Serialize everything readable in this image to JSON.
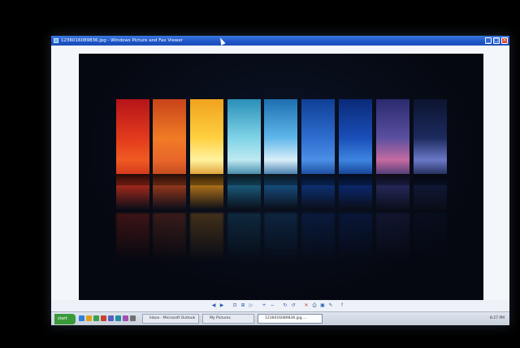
{
  "window": {
    "title": "1236016089836.jpg - Windows Picture and Fax Viewer",
    "minimize_icon": "minimize-icon",
    "maximize_icon": "maximize-icon",
    "close_icon": "close-icon"
  },
  "photo": {
    "strips": [
      {
        "colors": [
          "#b5141a",
          "#e23a1c",
          "#f05a22",
          "#c9301b"
        ]
      },
      {
        "colors": [
          "#c8431a",
          "#f07b25",
          "#e9672a",
          "#b8431d"
        ]
      },
      {
        "colors": [
          "#f0a21e",
          "#ffd040",
          "#fff2a0",
          "#d88a18"
        ]
      },
      {
        "colors": [
          "#2a8fb8",
          "#7fd3e6",
          "#bfe9f1",
          "#1e6d93"
        ]
      },
      {
        "colors": [
          "#1d6fb0",
          "#5fb7ea",
          "#d9eef8",
          "#1a5d96"
        ]
      },
      {
        "colors": [
          "#0f3f95",
          "#2e6ed0",
          "#4b8fe6",
          "#0d3a8a"
        ]
      },
      {
        "colors": [
          "#0a2a78",
          "#1a4eb8",
          "#3d85e0",
          "#0b2e80"
        ]
      },
      {
        "colors": [
          "#2a2a6e",
          "#5a4fa0",
          "#c56aa0",
          "#2c2f6a"
        ]
      },
      {
        "colors": [
          "#0c1430",
          "#1c2a5e",
          "#6a78c8",
          "#101a3c"
        ]
      }
    ]
  },
  "toolbar": {
    "icons": [
      "previous-icon",
      "next-icon",
      "best-fit-icon",
      "actual-size-icon",
      "slideshow-icon",
      "zoom-in-icon",
      "zoom-out-icon",
      "rotate-cw-icon",
      "rotate-ccw-icon",
      "delete-icon",
      "print-icon",
      "save-icon",
      "edit-icon",
      "help-icon"
    ]
  },
  "taskbar": {
    "start_label": "start",
    "tasks": [
      {
        "label": "Inbox - Microsoft Outlook",
        "active": false
      },
      {
        "label": "My Pictures",
        "active": false
      },
      {
        "label": "1236016089836.jpg ...",
        "active": true
      }
    ],
    "clock": "8:27 PM"
  }
}
